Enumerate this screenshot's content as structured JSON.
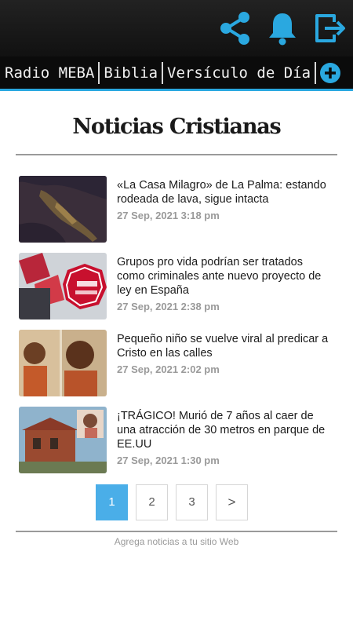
{
  "header": {
    "icons": [
      "share-icon",
      "bell-icon",
      "exit-icon"
    ],
    "accent": "#2aa8e0"
  },
  "nav": {
    "items": [
      {
        "label": "Radio MEBA"
      },
      {
        "label": "Biblia"
      },
      {
        "label": "Versículo de Día"
      }
    ],
    "add_icon": "plus-circle-icon"
  },
  "page": {
    "title": "Noticias Cristianas"
  },
  "news": [
    {
      "title": "«La Casa Milagro» de La Palma: estando rodeada de lava, sigue intacta",
      "date": "27 Sep, 2021 3:18 pm"
    },
    {
      "title": "Grupos pro vida podrían ser tratados como criminales ante nuevo proyecto de ley en España",
      "date": "27 Sep, 2021 2:38 pm"
    },
    {
      "title": "Pequeño niño se vuelve viral al predicar a Cristo en las calles",
      "date": "27 Sep, 2021 2:02 pm"
    },
    {
      "title": "¡TRÁGICO! Murió de 7 años al caer de una atracción de 30 metros en parque de EE.UU",
      "date": "27 Sep, 2021 1:30 pm"
    }
  ],
  "pagination": {
    "pages": [
      "1",
      "2",
      "3"
    ],
    "active": "1",
    "next_label": ">",
    "active_color": "#4aaee8"
  },
  "footer": {
    "link": "Agrega noticias a tu sitio Web"
  }
}
